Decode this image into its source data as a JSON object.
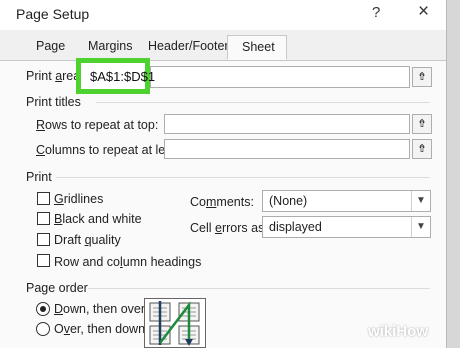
{
  "window": {
    "title": "Page Setup",
    "help_glyph": "?",
    "close_glyph": "×"
  },
  "tabs": [
    {
      "label": "Page",
      "active": false
    },
    {
      "label": "Margins",
      "active": false
    },
    {
      "label": "Header/Footer",
      "active": false
    },
    {
      "label": "Sheet",
      "active": true
    }
  ],
  "print_area": {
    "label_pre": "Print ",
    "label_ul": "a",
    "label_post": "rea:",
    "value": "$A$1:$D$1",
    "highlight_color": "#4ed230"
  },
  "print_titles": {
    "heading": "Print titles",
    "rows": {
      "label_ul": "R",
      "label_post": "ows to repeat at top:",
      "value": ""
    },
    "cols": {
      "label_ul": "C",
      "label_post": "olumns to repeat at left:",
      "value": ""
    }
  },
  "print": {
    "heading": "Print",
    "gridlines": {
      "label_ul": "G",
      "label_post": "ridlines",
      "checked": false
    },
    "black_white": {
      "label_ul": "B",
      "label_post": "lack and white",
      "checked": false
    },
    "draft": {
      "label_pre": "Draft ",
      "label_ul": "q",
      "label_post": "uality",
      "checked": false
    },
    "row_col_headings": {
      "label_pre": "Row and co",
      "label_ul": "l",
      "label_post": "umn headings",
      "checked": false
    },
    "comments": {
      "label_pre": "Co",
      "label_ul": "m",
      "label_post": "ments:",
      "value": "(None)"
    },
    "cell_errors": {
      "label_pre": "Cell ",
      "label_ul": "e",
      "label_post": "rrors as:",
      "value": "displayed"
    }
  },
  "page_order": {
    "heading": "Page order",
    "down_then_over": {
      "label_ul": "D",
      "label_post": "own, then over",
      "selected": true
    },
    "over_then_down": {
      "label_pre": "O",
      "label_ul": "v",
      "label_post": "er, then down",
      "selected": false
    }
  },
  "icons": {
    "collapse": "collapse-dialog-icon",
    "dropdown": "chevron-down-icon",
    "page_order_preview": "page-order-preview-icon"
  },
  "watermark": {
    "text": "wikiHow"
  }
}
